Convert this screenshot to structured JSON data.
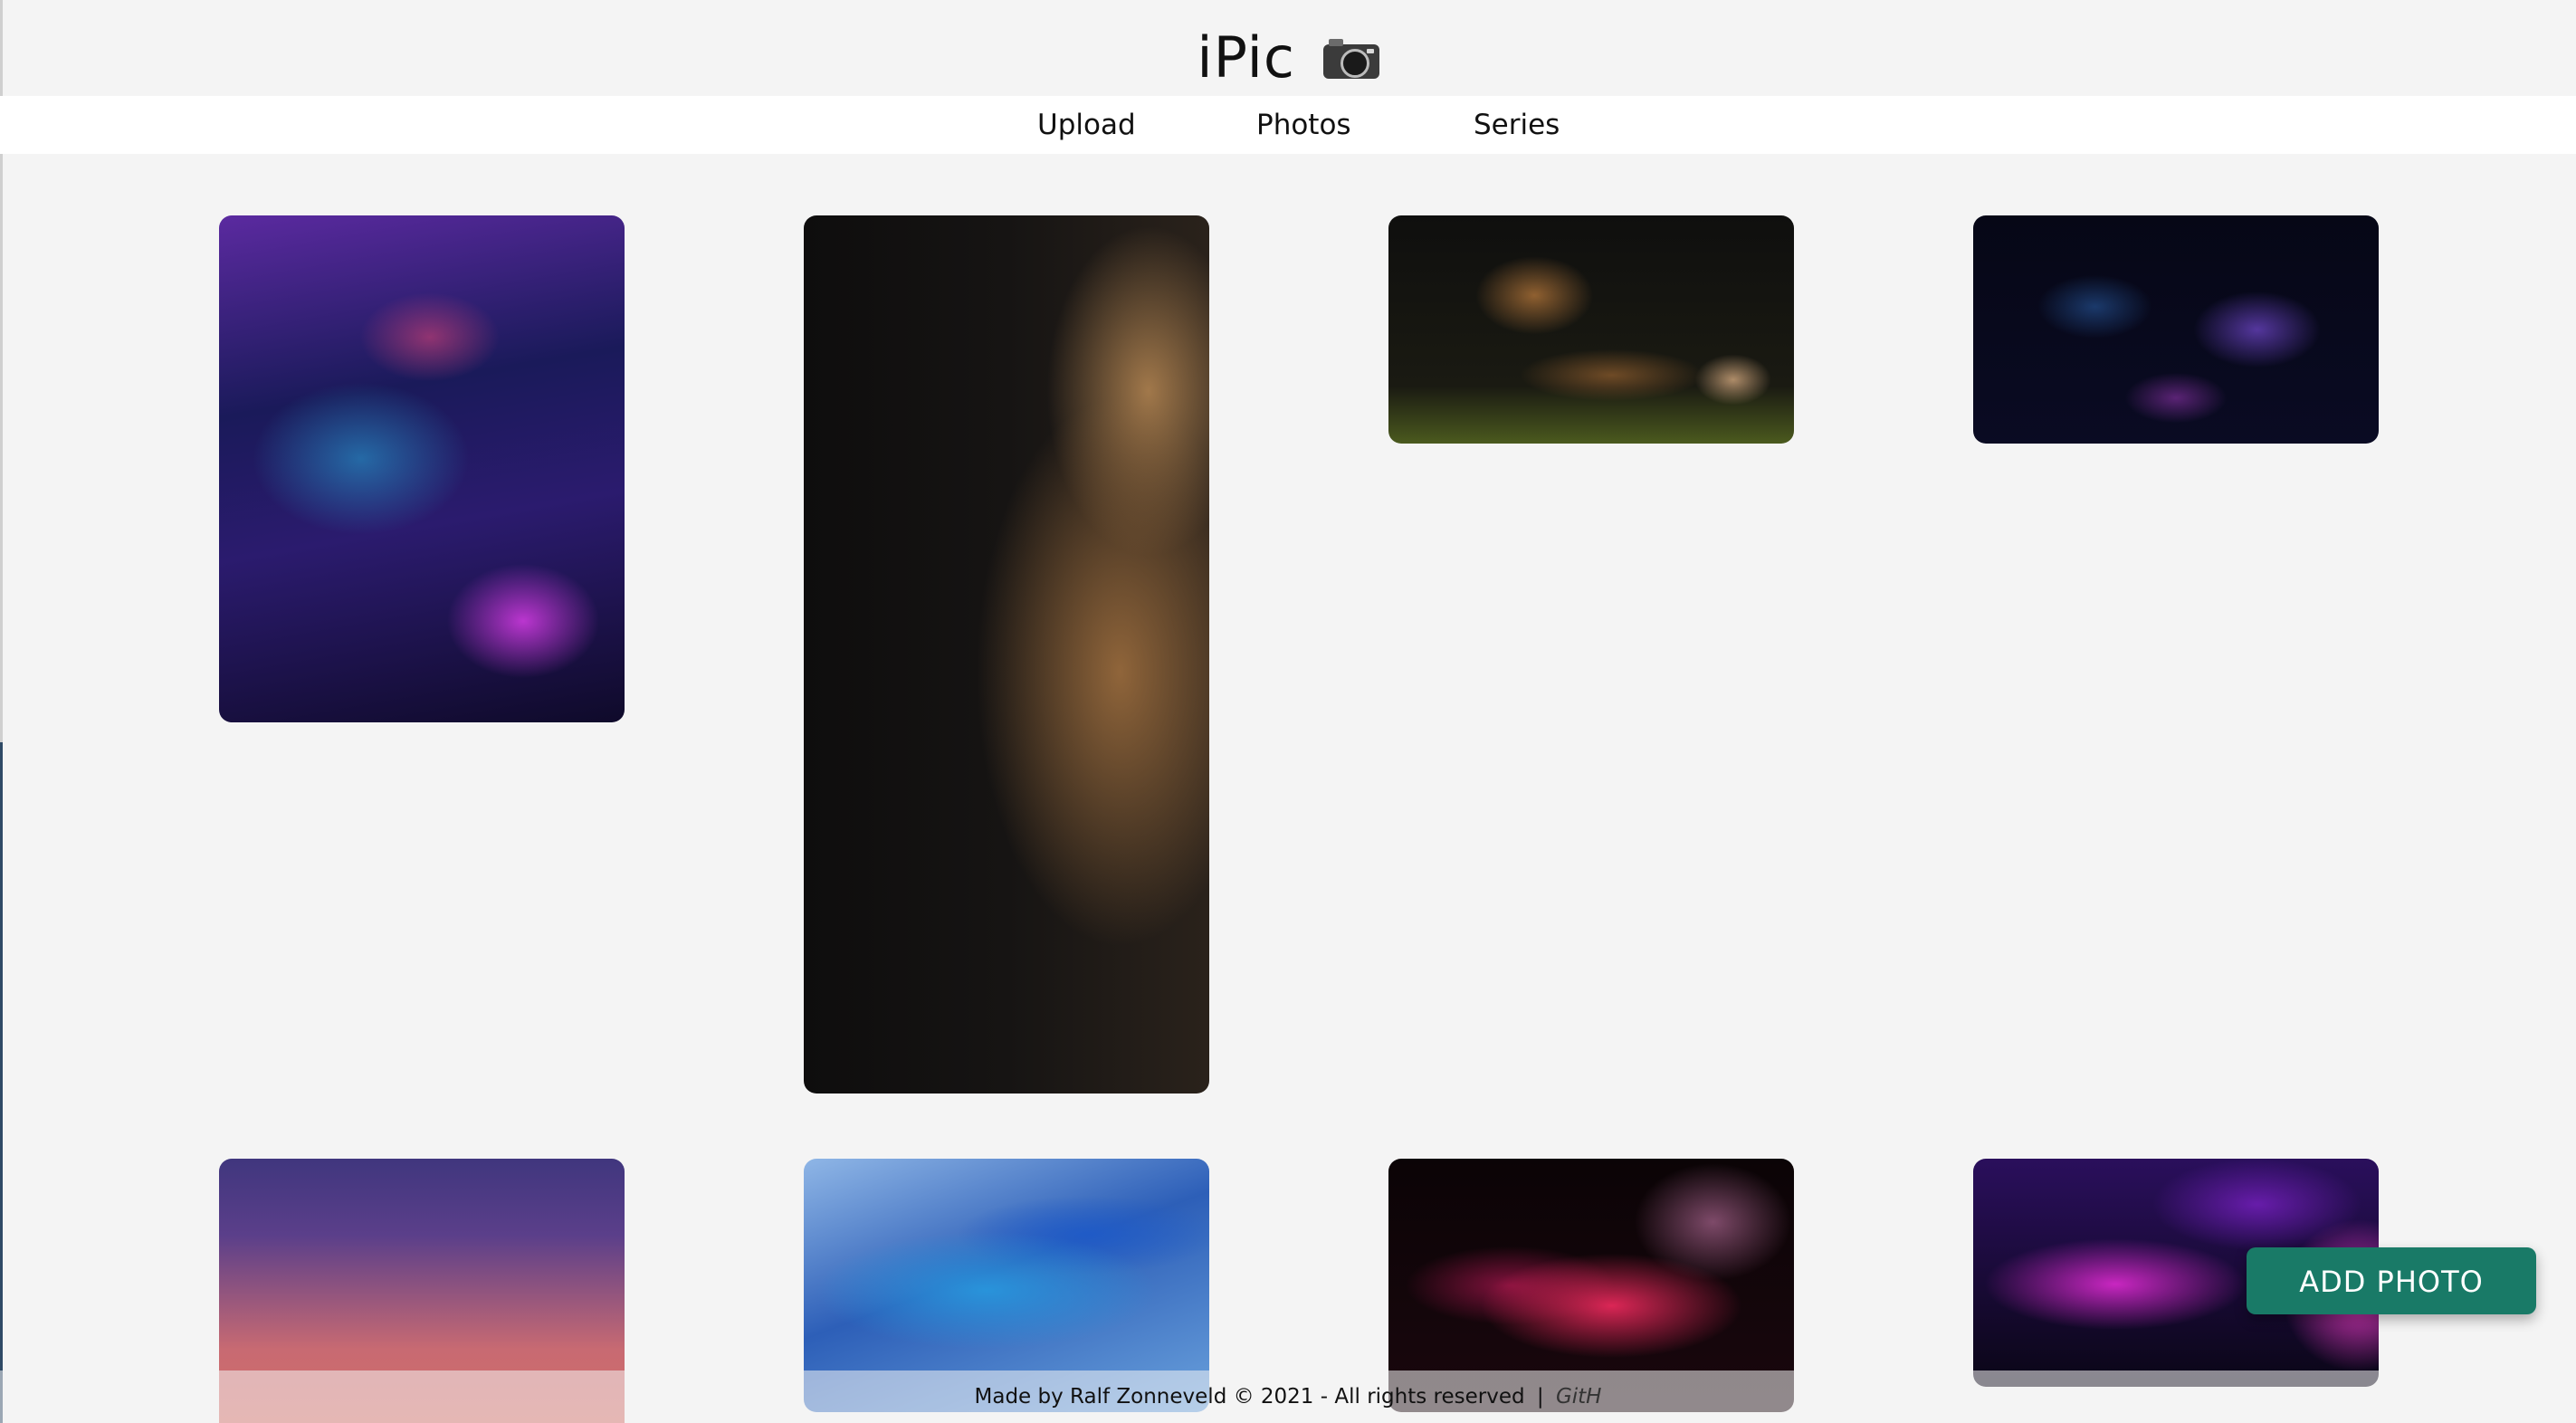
{
  "app": {
    "title": "iPic",
    "title_icon": "camera-icon"
  },
  "nav": {
    "items": [
      {
        "label": "Upload"
      },
      {
        "label": "Photos"
      },
      {
        "label": "Series"
      }
    ]
  },
  "gallery": {
    "photos": [
      {
        "subject": "car interior at night"
      },
      {
        "subject": "lion profile"
      },
      {
        "subject": "lion lying in grass"
      },
      {
        "subject": "nebula"
      },
      {
        "subject": "purple-orange gradient sky"
      },
      {
        "subject": "blue fabric wave"
      },
      {
        "subject": "red abstract lines"
      },
      {
        "subject": "purple abstract shapes"
      }
    ]
  },
  "actions": {
    "add_photo_label": "ADD PHOTO",
    "add_photo_color": "#197a67"
  },
  "footer": {
    "text": "Made by Ralf Zonneveld © 2021 - All rights reserved",
    "separator": "|",
    "link_label": "GitH"
  }
}
